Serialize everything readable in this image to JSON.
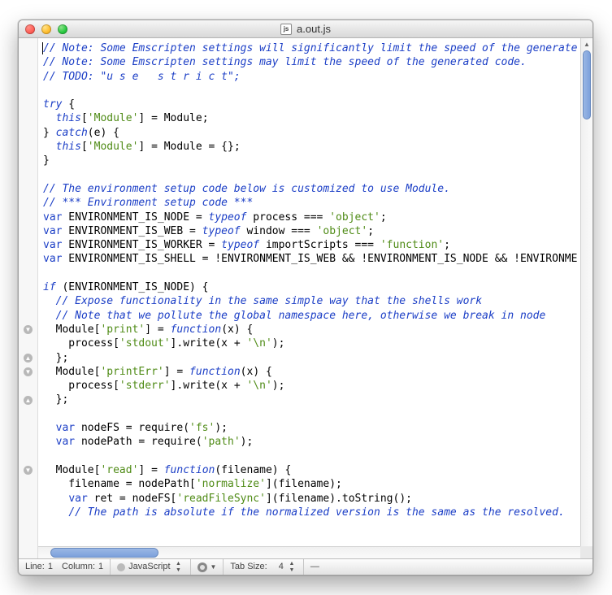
{
  "window": {
    "title": "a.out.js",
    "icon_label": "js"
  },
  "code_lines": [
    [
      [
        "cm",
        "// Note: Some Emscripten settings will significantly limit the speed of the generate"
      ]
    ],
    [
      [
        "cm",
        "// Note: Some Emscripten settings may limit the speed of the generated code."
      ]
    ],
    [
      [
        "cm",
        "// TODO: \"u s e   s t r i c t\";"
      ]
    ],
    [
      [
        "",
        ""
      ]
    ],
    [
      [
        "kw",
        "try"
      ],
      [
        "",
        " {"
      ]
    ],
    [
      [
        "",
        "  "
      ],
      [
        "kw",
        "this"
      ],
      [
        "",
        "["
      ],
      [
        "str",
        "'Module'"
      ],
      [
        "",
        "] = Module;"
      ]
    ],
    [
      [
        "",
        "} "
      ],
      [
        "kw",
        "catch"
      ],
      [
        "",
        "(e) {"
      ]
    ],
    [
      [
        "",
        "  "
      ],
      [
        "kw",
        "this"
      ],
      [
        "",
        "["
      ],
      [
        "str",
        "'Module'"
      ],
      [
        "",
        "] = Module = {};"
      ]
    ],
    [
      [
        "",
        "}"
      ]
    ],
    [
      [
        "",
        ""
      ]
    ],
    [
      [
        "cm",
        "// The environment setup code below is customized to use Module."
      ]
    ],
    [
      [
        "cm",
        "// *** Environment setup code ***"
      ]
    ],
    [
      [
        "kw2",
        "var"
      ],
      [
        "",
        " ENVIRONMENT_IS_NODE = "
      ],
      [
        "kw",
        "typeof"
      ],
      [
        "",
        " process === "
      ],
      [
        "str",
        "'object'"
      ],
      [
        "",
        ";"
      ]
    ],
    [
      [
        "kw2",
        "var"
      ],
      [
        "",
        " ENVIRONMENT_IS_WEB = "
      ],
      [
        "kw",
        "typeof"
      ],
      [
        "",
        " window === "
      ],
      [
        "str",
        "'object'"
      ],
      [
        "",
        ";"
      ]
    ],
    [
      [
        "kw2",
        "var"
      ],
      [
        "",
        " ENVIRONMENT_IS_WORKER = "
      ],
      [
        "kw",
        "typeof"
      ],
      [
        "",
        " importScripts === "
      ],
      [
        "str",
        "'function'"
      ],
      [
        "",
        ";"
      ]
    ],
    [
      [
        "kw2",
        "var"
      ],
      [
        "",
        " ENVIRONMENT_IS_SHELL = !ENVIRONMENT_IS_WEB && !ENVIRONMENT_IS_NODE && !ENVIRONME"
      ]
    ],
    [
      [
        "",
        ""
      ]
    ],
    [
      [
        "kw",
        "if"
      ],
      [
        "",
        " (ENVIRONMENT_IS_NODE) {"
      ]
    ],
    [
      [
        "",
        "  "
      ],
      [
        "cm",
        "// Expose functionality in the same simple way that the shells work"
      ]
    ],
    [
      [
        "",
        "  "
      ],
      [
        "cm",
        "// Note that we pollute the global namespace here, otherwise we break in node"
      ]
    ],
    [
      [
        "",
        "  Module["
      ],
      [
        "str",
        "'print'"
      ],
      [
        "",
        "] = "
      ],
      [
        "kw",
        "function"
      ],
      [
        "",
        "(x) {"
      ]
    ],
    [
      [
        "",
        "    process["
      ],
      [
        "str",
        "'stdout'"
      ],
      [
        "",
        "].write(x + "
      ],
      [
        "str",
        "'\\n'"
      ],
      [
        "",
        ");"
      ]
    ],
    [
      [
        "",
        "  };"
      ]
    ],
    [
      [
        "",
        "  Module["
      ],
      [
        "str",
        "'printErr'"
      ],
      [
        "",
        "] = "
      ],
      [
        "kw",
        "function"
      ],
      [
        "",
        "(x) {"
      ]
    ],
    [
      [
        "",
        "    process["
      ],
      [
        "str",
        "'stderr'"
      ],
      [
        "",
        "].write(x + "
      ],
      [
        "str",
        "'\\n'"
      ],
      [
        "",
        ");"
      ]
    ],
    [
      [
        "",
        "  };"
      ]
    ],
    [
      [
        "",
        ""
      ]
    ],
    [
      [
        "",
        "  "
      ],
      [
        "kw2",
        "var"
      ],
      [
        "",
        " nodeFS = require("
      ],
      [
        "str",
        "'fs'"
      ],
      [
        "",
        ");"
      ]
    ],
    [
      [
        "",
        "  "
      ],
      [
        "kw2",
        "var"
      ],
      [
        "",
        " nodePath = require("
      ],
      [
        "str",
        "'path'"
      ],
      [
        "",
        ");"
      ]
    ],
    [
      [
        "",
        ""
      ]
    ],
    [
      [
        "",
        "  Module["
      ],
      [
        "str",
        "'read'"
      ],
      [
        "",
        "] = "
      ],
      [
        "kw",
        "function"
      ],
      [
        "",
        "(filename) {"
      ]
    ],
    [
      [
        "",
        "    filename = nodePath["
      ],
      [
        "str",
        "'normalize'"
      ],
      [
        "",
        "](filename);"
      ]
    ],
    [
      [
        "",
        "    "
      ],
      [
        "kw2",
        "var"
      ],
      [
        "",
        " ret = nodeFS["
      ],
      [
        "str",
        "'readFileSync'"
      ],
      [
        "",
        "](filename).toString();"
      ]
    ],
    [
      [
        "",
        "    "
      ],
      [
        "cm",
        "// The path is absolute if the normalized version is the same as the resolved."
      ]
    ]
  ],
  "fold_markers": [
    {
      "line": 20,
      "dir": "down"
    },
    {
      "line": 22,
      "dir": "up"
    },
    {
      "line": 23,
      "dir": "down"
    },
    {
      "line": 25,
      "dir": "up"
    },
    {
      "line": 30,
      "dir": "down"
    }
  ],
  "status": {
    "line_label": "Line:",
    "line_value": "1",
    "col_label": "Column:",
    "col_value": "1",
    "language": "JavaScript",
    "tabsize_label": "Tab Size:",
    "tabsize_value": "4",
    "extra": "—"
  }
}
